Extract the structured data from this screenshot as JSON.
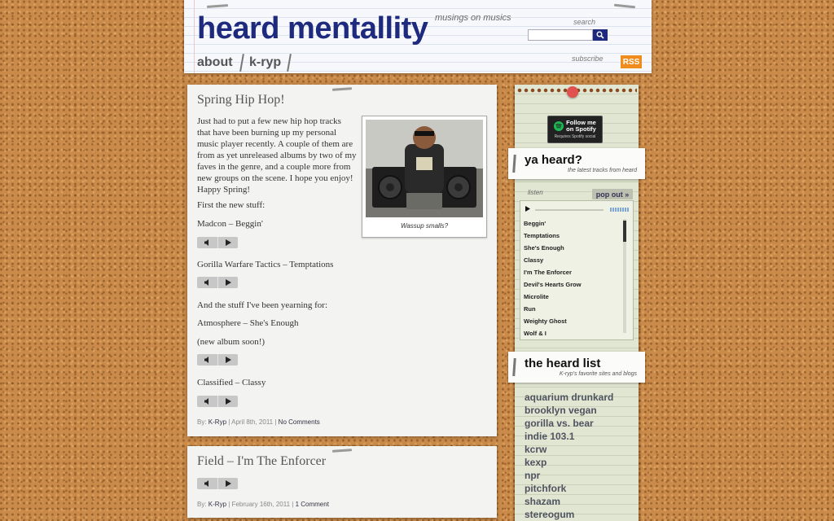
{
  "header": {
    "title": "heard mentallity",
    "tagline": "musings on musics",
    "nav": [
      "about",
      "k-ryp"
    ],
    "search": {
      "label": "search",
      "placeholder": ""
    },
    "subscribe": {
      "label": "subscribe",
      "rss_label": "RSS"
    },
    "colors": {
      "title": "#1d2a7d",
      "rss": "#f08c1e"
    }
  },
  "posts": [
    {
      "title": "Spring Hip Hop!",
      "paragraphs": [
        "Just had to put a few new hip hop tracks that have been burning up my personal music player recently.  A couple of them are from as yet unreleased albums by two of my faves in the genre, and a couple more from new groups on the scene.  I hope you enjoy! Happy Spring!",
        "First the new stuff:",
        "Madcon – Beggin'",
        "Gorilla Warfare Tactics – Temptations",
        "And the stuff I've been yearning for:",
        "Atmosphere – She's Enough",
        "(new album soon!)",
        "Classified – Classy"
      ],
      "image_caption": "Wassup smalls?",
      "meta": {
        "by": "By:",
        "author": "K-Ryp",
        "date": "April 8th, 2011",
        "comments": "No Comments"
      }
    },
    {
      "title": "Field – I'm The Enforcer",
      "meta": {
        "by": "By:",
        "author": "K-Ryp",
        "date": "February 16th, 2011",
        "comments": "1 Comment"
      }
    }
  ],
  "sidebar": {
    "spotify": {
      "line1": "Follow me",
      "line2": "on Spotify",
      "sub": "Requires Spotify social"
    },
    "ya_heard": {
      "title": "ya heard?",
      "subtitle": "the latest tracks from heard"
    },
    "listen_label": "listen",
    "popout_label": "pop out »",
    "playlist": [
      "Beggin'",
      "Temptations",
      "She's Enough",
      "Classy",
      "I'm The Enforcer",
      "Devil's Hearts Grow",
      "Microlite",
      "Run",
      "Weighty Ghost",
      "Wolf & I"
    ],
    "heard_list": {
      "title": "the heard list",
      "subtitle": "K-ryp's favorite sites and blogs"
    },
    "blogroll": [
      "aquarium drunkard",
      "brooklyn vegan",
      "gorilla vs. bear",
      "indie 103.1",
      "kcrw",
      "kexp",
      "npr",
      "pitchfork",
      "shazam",
      "stereogum"
    ]
  }
}
